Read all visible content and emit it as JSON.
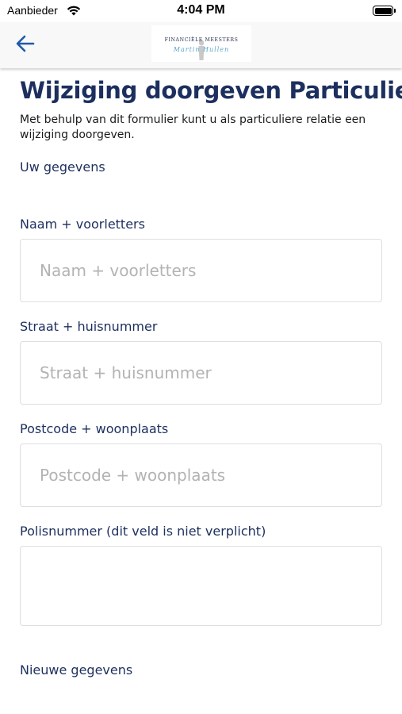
{
  "status": {
    "carrier": "Aanbieder",
    "time": "4:04 PM",
    "battery_level": 1.0
  },
  "nav": {
    "logo_text": "FINANCIËLE MEESTERS",
    "logo_script": "Martin Hullen"
  },
  "page": {
    "title": "Wijziging doorgeven Particulier",
    "intro": "Met behulp van dit formulier kunt u als particuliere relatie een wijziging doorgeven."
  },
  "form": {
    "section_current": "Uw gegevens",
    "name": {
      "label": "Naam + voorletters",
      "placeholder": "Naam + voorletters",
      "value": ""
    },
    "street": {
      "label": "Straat + huisnummer",
      "placeholder": "Straat + huisnummer",
      "value": ""
    },
    "postcode": {
      "label": "Postcode + woonplaats",
      "placeholder": "Postcode + woonplaats",
      "value": ""
    },
    "policy": {
      "label": "Polisnummer (dit veld is niet verplicht)",
      "placeholder": "",
      "value": ""
    },
    "section_new": "Nieuwe gegevens"
  },
  "colors": {
    "primary": "#1c2f5e",
    "nav_bg": "#f8f8f8",
    "back_icon": "#1e5ba8",
    "border": "#dedede",
    "placeholder": "#b3b3b3"
  }
}
